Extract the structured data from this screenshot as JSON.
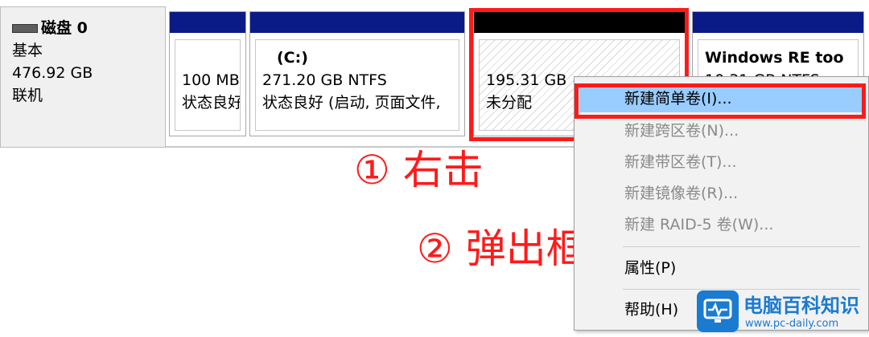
{
  "disk": {
    "name": "磁盘 0",
    "type": "基本",
    "size": "476.92 GB",
    "status": "联机"
  },
  "partitions": [
    {
      "title": "",
      "size_line": "100 MB",
      "status_line": "状态良好"
    },
    {
      "title": "(C:)",
      "size_line": "271.20 GB NTFS",
      "status_line": "状态良好 (启动, 页面文件,"
    },
    {
      "title": "",
      "size_line": "195.31 GB",
      "status_line": "未分配"
    },
    {
      "title": "Windows RE too",
      "size_line": "10.31 GB NTFS",
      "status_line": ""
    }
  ],
  "context_menu": {
    "items": [
      {
        "label": "新建简单卷(I)...",
        "enabled": true,
        "selected": true
      },
      {
        "label": "新建跨区卷(N)...",
        "enabled": false
      },
      {
        "label": "新建带区卷(T)...",
        "enabled": false
      },
      {
        "label": "新建镜像卷(R)...",
        "enabled": false
      },
      {
        "label": "新建 RAID-5 卷(W)...",
        "enabled": false
      },
      {
        "label": "属性(P)",
        "enabled": true
      },
      {
        "label": "帮助(H)",
        "enabled": true
      }
    ]
  },
  "annotations": {
    "step1": "① 右击",
    "step2": "② 弹出框"
  },
  "watermark": {
    "text": "电脑百科知识",
    "url": "www.pc-daily.com"
  },
  "colors": {
    "volume_bar": "#0a1a86",
    "unallocated_bar": "#000000",
    "highlight": "#ff1a1a",
    "menu_selected": "#99ccff"
  }
}
